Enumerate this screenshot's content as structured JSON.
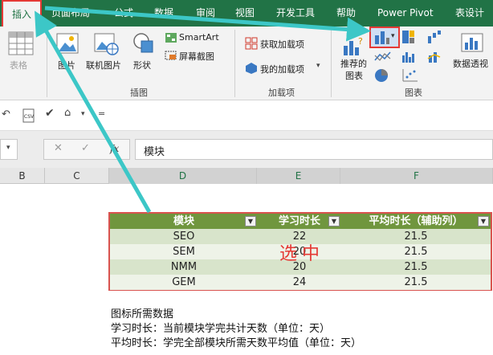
{
  "ribbon_tabs": [
    "插入",
    "页面布局",
    "公式",
    "数据",
    "审阅",
    "视图",
    "开发工具",
    "帮助",
    "Power Pivot",
    "表设计"
  ],
  "groups": {
    "tables": {
      "button": "表格"
    },
    "illustrations": {
      "label": "插图",
      "picture": "图片",
      "online_picture": "联机图片",
      "shapes": "形状",
      "smartart": "SmartArt",
      "screenshot": "屏幕截图"
    },
    "addins": {
      "label": "加载项",
      "get_addins": "获取加载项",
      "my_addins": "我的加载项"
    },
    "charts": {
      "label": "图表",
      "recommended_line1": "推荐的",
      "recommended_line2": "图表",
      "pivot_chart": "数据透视"
    }
  },
  "formula_bar": {
    "fx": "fx",
    "value": "模块"
  },
  "columns": [
    "B",
    "C",
    "D",
    "E",
    "F"
  ],
  "table": {
    "headers": [
      "模块",
      "学习时长",
      "平均时长（辅助列）"
    ],
    "rows": [
      [
        "SEO",
        "22",
        "21.5"
      ],
      [
        "SEM",
        "20",
        "21.5"
      ],
      [
        "NMM",
        "20",
        "21.5"
      ],
      [
        "GEM",
        "24",
        "21.5"
      ]
    ]
  },
  "annotation": "选中",
  "notes": [
    "图标所需数据",
    "学习时长：当前模块学完共计天数（单位：天）",
    "平均时长：学完全部模块所需天数平均值（单位：天）"
  ],
  "colors": {
    "excel_green": "#217346",
    "highlight_red": "#e53935",
    "arrow_teal": "#3cc7c7",
    "table_header": "#70963e",
    "table_band": "#d8e4cb"
  }
}
